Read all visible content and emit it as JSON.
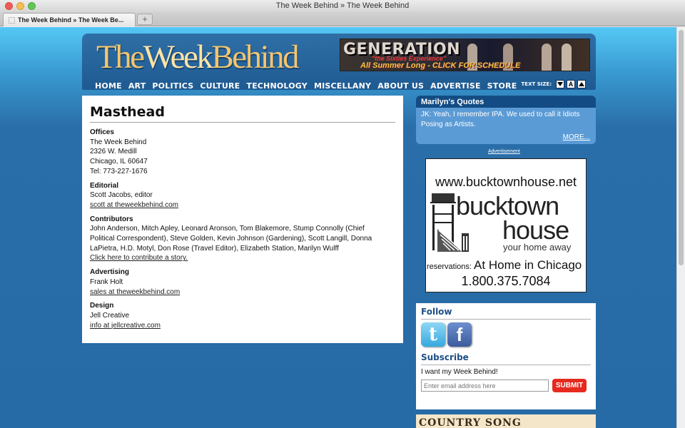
{
  "window": {
    "title": "The Week Behind » The Week Behind"
  },
  "tabs": [
    {
      "label": "The Week Behind » The Week Be..."
    }
  ],
  "newtab": "+",
  "header": {
    "logo": {
      "part1": "The",
      "part2": "Week",
      "part3": "Behind"
    },
    "banner": {
      "title": "GENERATION",
      "subtitle": "\"the Sixties Experience\"",
      "cta": "All Summer Long - CLICK FOR SCHEDULE"
    },
    "nav": [
      "HOME",
      "ART",
      "POLITICS",
      "CULTURE",
      "TECHNOLOGY",
      "MISCELLANY",
      "ABOUT US",
      "ADVERTISE",
      "STORE"
    ],
    "text_size": {
      "label": "TEXT SIZE:",
      "increase_label": "A"
    }
  },
  "masthead": {
    "title": "Masthead",
    "offices": {
      "heading": "Offices",
      "lines": [
        "The Week Behind",
        "2326 W. Medill",
        "Chicago, IL 60647",
        "Tel: 773-227-1676"
      ]
    },
    "editorial": {
      "heading": "Editorial",
      "name": "Scott Jacobs, editor",
      "email": "scott at theweekbehind.com"
    },
    "contributors": {
      "heading": "Contributors",
      "names": "John Anderson, Mitch Apley, Leonard Aronson, Tom Blakemore, Stump Connolly (Chief Political Correspondent), Steve Golden, Kevin Johnson (Gardening), Scott Langill, Donna LaPietra, H.D. Motyl, Don Rose (Travel Editor), Elizabeth Station, Marilyn Wulff",
      "link": "Click here to contribute a story."
    },
    "advertising": {
      "heading": "Advertising",
      "name": "Frank Holt",
      "email": "sales at theweekbehind.com"
    },
    "design": {
      "heading": "Design",
      "name": "Jell Creative",
      "email": "info at jellcreative.com"
    }
  },
  "sidebar": {
    "quotes": {
      "heading": "Marilyn's Quotes",
      "text": "JK: Yeah, I remember IPA. We used to call it Idiots Posing as Artists.",
      "more": "MORE..."
    },
    "ad_label": "Advertisement",
    "ad": {
      "url": "www.bucktownhouse.net",
      "brand_line1": "bucktown",
      "brand_line2": "house",
      "tagline": "your home away",
      "reservations": "reservations:",
      "at_home": "At Home in Chicago",
      "phone": "1.800.375.7084"
    },
    "follow": {
      "heading": "Follow",
      "twitter_glyph": "t",
      "facebook_glyph": "f"
    },
    "subscribe": {
      "heading": "Subscribe",
      "text": "I want my Week Behind!",
      "placeholder": "Enter email address here",
      "button": "SUBMIT"
    },
    "country_ad": {
      "text": "COUNTRY SONG"
    }
  },
  "colors": {
    "header_blue": "#1e5a92",
    "logo_gold": "#f3c56d",
    "quotes_blue": "#5b9bd5",
    "submit_red": "#e52b1f",
    "heading_blue": "#1e4f85"
  }
}
